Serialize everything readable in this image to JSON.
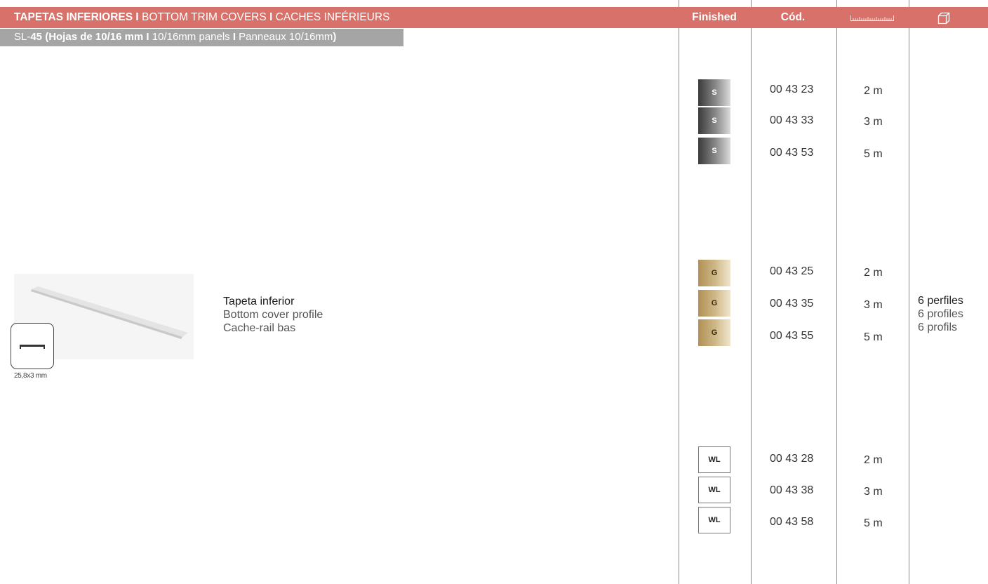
{
  "header": {
    "title_bold_1": "TAPETAS INFERIORES I",
    "title_normal_1": " BOTTOM TRIM COVERS ",
    "title_bold_2": "I",
    "title_normal_2": " CACHES INFÉRIEURS",
    "col_finished": "Finished",
    "col_code": "Cód.",
    "length_icon": "ruler-icon",
    "package_icon": "box-icon"
  },
  "subtitle": {
    "part1": "SL-",
    "part2": "45 (Hojas de 10/16 mm I",
    "part3": " 10/16mm panels ",
    "part4": "I",
    "part5": " Panneaux 10/16mm",
    "part6": ")"
  },
  "product": {
    "dimension": "25,8x3 mm",
    "name_es": "Tapeta inferior",
    "name_en": "Bottom cover profile",
    "name_fr": "Cache-rail bas"
  },
  "rows": [
    {
      "finish": "S",
      "code": "00 43 23",
      "length": "2 m"
    },
    {
      "finish": "S",
      "code": "00 43 33",
      "length": "3 m"
    },
    {
      "finish": "S",
      "code": "00 43 53",
      "length": "5 m"
    },
    {
      "finish": "G",
      "code": "00 43 25",
      "length": "2 m"
    },
    {
      "finish": "G",
      "code": "00 43 35",
      "length": "3 m"
    },
    {
      "finish": "G",
      "code": "00 43 55",
      "length": "5 m"
    },
    {
      "finish": "WL",
      "code": "00 43 28",
      "length": "2 m"
    },
    {
      "finish": "WL",
      "code": "00 43 38",
      "length": "3 m"
    },
    {
      "finish": "WL",
      "code": "00 43 58",
      "length": "5 m"
    }
  ],
  "package": {
    "es": "6 perfiles",
    "en": "6 profiles",
    "fr": "6 profils"
  },
  "colors": {
    "header_bg": "#d7716a",
    "subtitle_bg": "#a5a5a5"
  }
}
